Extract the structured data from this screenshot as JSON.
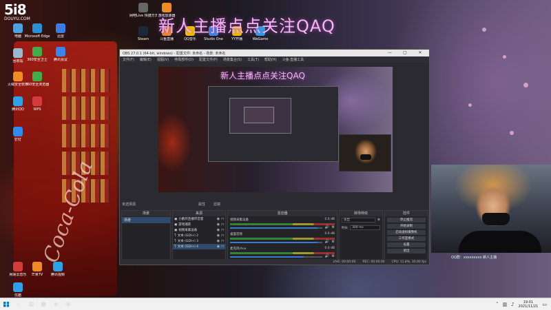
{
  "watermark": {
    "number": "5i8",
    "site": "DOUYU.COM"
  },
  "banner": "新人主播点点关注QAQ",
  "desktop_icons": [
    {
      "label": "电脑",
      "color": "#4aa3e0"
    },
    {
      "label": "Microsoft Edge",
      "color": "#2b8fd6"
    },
    {
      "label": "回收站",
      "color": "#9cb8d0"
    },
    {
      "label": "火绒安全软件",
      "color": "#f08a24"
    },
    {
      "label": "360安全卫士",
      "color": "#3fae4a"
    },
    {
      "label": "360安全浏览器",
      "color": "#3fae4a"
    },
    {
      "label": "腾讯QQ",
      "color": "#2ba3e8"
    },
    {
      "label": "迅雷",
      "color": "#3c7be0"
    },
    {
      "label": "腾讯会议",
      "color": "#3a86e8"
    },
    {
      "label": "钉钉",
      "color": "#2e8cf0"
    },
    {
      "label": "WPS",
      "color": "#d43c3c"
    },
    {
      "label": "网易云音乐",
      "color": "#d43c3c"
    },
    {
      "label": "优酷",
      "color": "#2fa0ea"
    },
    {
      "label": "芒果TV",
      "color": "#f08a24"
    },
    {
      "label": "腾讯视频",
      "color": "#2ba3e8"
    }
  ],
  "top_icons": [
    {
      "label": "网吧Live 快捷方式",
      "color": "#666"
    },
    {
      "label": "游戏加速器",
      "color": "#f08a24"
    },
    {
      "label": "Steam",
      "color": "#1b2838"
    },
    {
      "label": "斗鱼直播",
      "color": "#f08a24"
    },
    {
      "label": "QQ音乐",
      "color": "#f4c000"
    },
    {
      "label": "Studio One",
      "color": "#3a86e8"
    },
    {
      "label": "YY开播",
      "color": "#f4c000"
    },
    {
      "label": "WeGame",
      "color": "#2ba3e8"
    }
  ],
  "obs": {
    "title": "OBS 27.0.1 (64-bit, windows) - 配置文件: 未命名 - 场景: 未命名",
    "menu": [
      "文件(F)",
      "编辑(E)",
      "视图(V)",
      "停靠部件(D)",
      "配置文件(P)",
      "场景集合(S)",
      "工具(T)",
      "帮助(H)",
      "斗鱼·直播工具"
    ],
    "preview_banner": "新人主播点点关注QAQ",
    "no_source": "未选择源",
    "toolbar": [
      "属性",
      "滤镜"
    ],
    "docks": {
      "scenes": {
        "title": "场景",
        "items": [
          "场景"
        ]
      },
      "sources": {
        "title": "来源",
        "items": [
          "小鹏开直播带音量",
          "游戏捕获",
          "视频采集设备",
          "文本 (GDI+) 2",
          "文本 (GDI+) 3",
          "文本 (GDI+) 4"
        ]
      },
      "mixer": {
        "title": "混音器",
        "tracks": [
          {
            "name": "视频采集设备",
            "db": "0.0 dB",
            "volume": 0.95
          },
          {
            "name": "桌面音频",
            "db": "0.0 dB",
            "volume": 0.95
          },
          {
            "name": "麦克风/Aux",
            "db": "0.0 dB",
            "volume": 0.8
          }
        ]
      },
      "transitions": {
        "title": "转场特效",
        "effect": "淡出",
        "duration_label": "时长",
        "duration": "300 ms"
      },
      "controls": {
        "title": "控件",
        "buttons": [
          "停止推流",
          "开始录制",
          "启动虚拟摄像机",
          "工作室模式",
          "设置",
          "退出"
        ]
      }
    },
    "status": {
      "live": "LIVE: 00:00:00",
      "rec": "REC: 00:00:00",
      "cpu": "CPU: 11.8%, 30.00 fps"
    }
  },
  "webcam_caption": "QQ群：xxxxxxxxx 新人主播",
  "taskbar": {
    "apps": [
      "⌕",
      "▦",
      "●",
      "◈",
      "◉"
    ],
    "time": "19:01",
    "date": "2021/11/21"
  }
}
